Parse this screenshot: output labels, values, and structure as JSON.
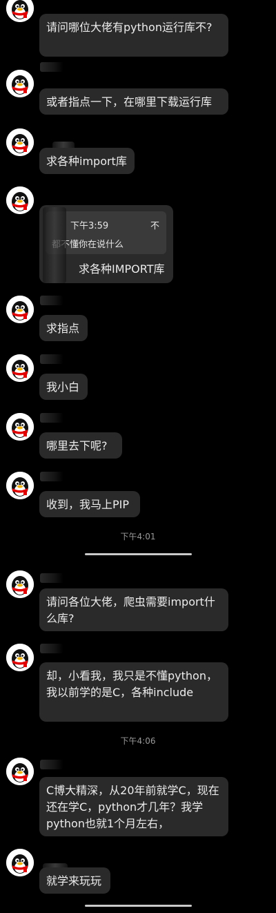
{
  "messages": {
    "m1": "请问哪位大佬有python运行库不?",
    "m2": "或者指点一下，在哪里下载运行库",
    "m3": "求各种import库",
    "m4": {
      "quote_time": "下午3:59",
      "quote_icon": "不",
      "quote_text": "都不懂你在说什么",
      "reply": "求各种IMPORT库"
    },
    "m5": "求指点",
    "m6": "我小白",
    "m7": "哪里去下呢?",
    "m8": "收到，我马上PIP",
    "m9": "请问各位大佬，爬虫需要import什么库?",
    "m10": "却，小看我，我只是不懂python，我以前学的是C，各种include",
    "m11": "C博大精深，从20年前就学C，现在还在学C，python才几年？我学python也就1个月左右，",
    "m12": "就学来玩玩"
  },
  "timestamps": {
    "t1": "下午4:01",
    "t2": "下午4:06"
  },
  "icons": {
    "avatar": "qq-penguin-icon"
  },
  "colors": {
    "background": "#000000",
    "bubble": "#2a2a2a",
    "text": "#ececec"
  }
}
